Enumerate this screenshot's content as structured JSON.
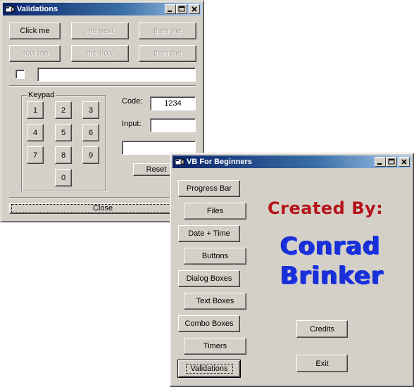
{
  "validations": {
    "title": "Validations",
    "buttons": {
      "click_me": "Click me",
      "me_next": "me next",
      "then_me_1": "then me",
      "now_me": "now me",
      "me_now": "me now",
      "then_me_2": "then me"
    },
    "keypad": {
      "title": "Keypad",
      "keys": [
        "1",
        "2",
        "3",
        "4",
        "5",
        "6",
        "7",
        "8",
        "9",
        "0"
      ]
    },
    "code_label": "Code:",
    "code_value": "1234",
    "input_label": "Input:",
    "input_value": "",
    "reset_label": "Reset",
    "close_label": "Close"
  },
  "vb": {
    "title": "VB For Beginners",
    "menu": {
      "progress_bar": "Progress Bar",
      "files": "Files",
      "date_time": "Date + Time",
      "buttons": "Buttons",
      "dialog_boxes": "Dialog Boxes",
      "text_boxes": "Text Boxes",
      "combo_boxes": "Combo Boxes",
      "timers": "Timers",
      "validations": "Validations"
    },
    "created_by": "Created By:",
    "author_first": "Conrad",
    "author_last": "Brinker",
    "credits_label": "Credits",
    "exit_label": "Exit"
  },
  "colors": {
    "titlebar_start": "#0a246a",
    "titlebar_end": "#a6caf0",
    "created_by": "#b4141a",
    "author": "#1a2fd8"
  }
}
